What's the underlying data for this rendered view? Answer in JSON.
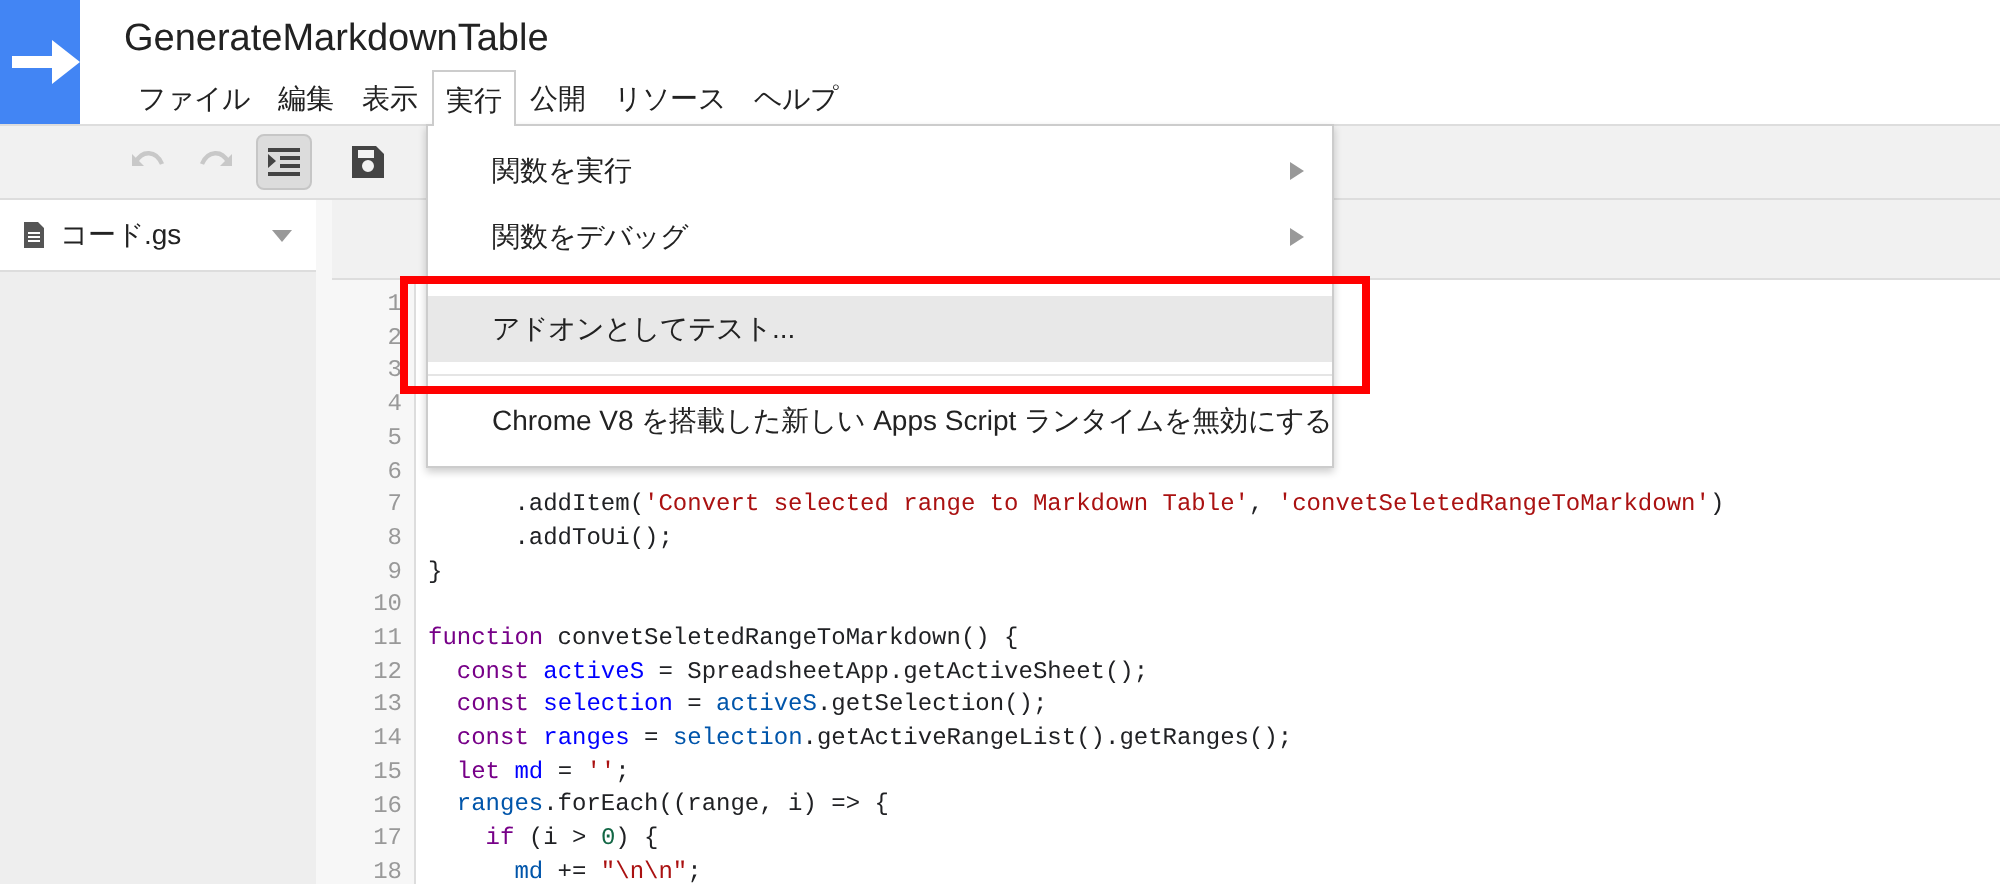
{
  "header": {
    "title": "GenerateMarkdownTable"
  },
  "menu_bar": [
    {
      "label": "ファイル",
      "selected": false
    },
    {
      "label": "編集",
      "selected": false
    },
    {
      "label": "表示",
      "selected": false
    },
    {
      "label": "実行",
      "selected": true
    },
    {
      "label": "公開",
      "selected": false
    },
    {
      "label": "リソース",
      "selected": false
    },
    {
      "label": "ヘルプ",
      "selected": false
    }
  ],
  "toolbar": [
    {
      "kind": "undo",
      "disabled": true,
      "active": false
    },
    {
      "kind": "redo",
      "disabled": true,
      "active": false
    },
    {
      "kind": "indent",
      "disabled": false,
      "active": true
    },
    {
      "kind": "save",
      "disabled": false,
      "active": false
    }
  ],
  "sidebar": {
    "files": [
      {
        "name": "コード.gs",
        "selected": true
      }
    ]
  },
  "dropdown": {
    "items": [
      {
        "kind": "item",
        "label": "関数を実行",
        "submenu": true,
        "highlighted": false
      },
      {
        "kind": "item",
        "label": "関数をデバッグ",
        "submenu": true,
        "highlighted": false
      },
      {
        "kind": "divider"
      },
      {
        "kind": "item",
        "label": "アドオンとしてテスト...",
        "submenu": false,
        "highlighted": true
      },
      {
        "kind": "divider"
      },
      {
        "kind": "item",
        "label": "Chrome V8 を搭載した新しい Apps Script ランタイムを無効にする",
        "submenu": false,
        "highlighted": false
      }
    ]
  },
  "annotation": {
    "kind": "frame",
    "color": "#ff0000"
  },
  "editor": {
    "lines": [
      {
        "number": "1"
      },
      {
        "number": "2"
      },
      {
        "number": "3"
      },
      {
        "number": "4"
      },
      {
        "number": "5"
      },
      {
        "number": "6"
      },
      {
        "number": "7",
        "tokens": [
          {
            "text": "      .addItem(",
            "kind": "plain"
          },
          {
            "text": "'Convert selected range to Markdown Table'",
            "kind": "string"
          },
          {
            "text": ", ",
            "kind": "plain"
          },
          {
            "text": "'convetSeletedRangeToMarkdown'",
            "kind": "string"
          },
          {
            "text": ")",
            "kind": "plain"
          }
        ]
      },
      {
        "number": "8",
        "tokens": [
          {
            "text": "      .addToUi();",
            "kind": "plain"
          }
        ]
      },
      {
        "number": "9",
        "tokens": [
          {
            "text": "}",
            "kind": "plain"
          }
        ]
      },
      {
        "number": "10"
      },
      {
        "number": "11",
        "tokens": [
          {
            "text": "function",
            "kind": "keyword"
          },
          {
            "text": " convetSeletedRangeToMarkdown() {",
            "kind": "plain"
          }
        ]
      },
      {
        "number": "12",
        "tokens": [
          {
            "text": "  const",
            "kind": "keyword"
          },
          {
            "text": " activeS",
            "kind": "def"
          },
          {
            "text": " = SpreadsheetApp.getActiveSheet();",
            "kind": "plain"
          }
        ]
      },
      {
        "number": "13",
        "tokens": [
          {
            "text": "  const",
            "kind": "keyword"
          },
          {
            "text": " selection",
            "kind": "def"
          },
          {
            "text": " = ",
            "kind": "plain"
          },
          {
            "text": "activeS",
            "kind": "var"
          },
          {
            "text": ".getSelection();",
            "kind": "plain"
          }
        ]
      },
      {
        "number": "14",
        "tokens": [
          {
            "text": "  const",
            "kind": "keyword"
          },
          {
            "text": " ranges",
            "kind": "def"
          },
          {
            "text": " = ",
            "kind": "plain"
          },
          {
            "text": "selection",
            "kind": "var"
          },
          {
            "text": ".getActiveRangeList().getRanges();",
            "kind": "plain"
          }
        ]
      },
      {
        "number": "15",
        "tokens": [
          {
            "text": "  let",
            "kind": "keyword"
          },
          {
            "text": " md",
            "kind": "def"
          },
          {
            "text": " = ",
            "kind": "plain"
          },
          {
            "text": "''",
            "kind": "string"
          },
          {
            "text": ";",
            "kind": "plain"
          }
        ]
      },
      {
        "number": "16",
        "tokens": [
          {
            "text": "  ranges",
            "kind": "var"
          },
          {
            "text": ".forEach((range, i) => {",
            "kind": "plain"
          }
        ]
      },
      {
        "number": "17",
        "tokens": [
          {
            "text": "    if",
            "kind": "keyword"
          },
          {
            "text": " (i > ",
            "kind": "plain"
          },
          {
            "text": "0",
            "kind": "number"
          },
          {
            "text": ") {",
            "kind": "plain"
          }
        ]
      },
      {
        "number": "18",
        "tokens": [
          {
            "text": "      md",
            "kind": "var"
          },
          {
            "text": " += ",
            "kind": "plain"
          },
          {
            "text": "\"\\n\\n\"",
            "kind": "string"
          },
          {
            "text": ";",
            "kind": "plain"
          }
        ]
      }
    ]
  }
}
